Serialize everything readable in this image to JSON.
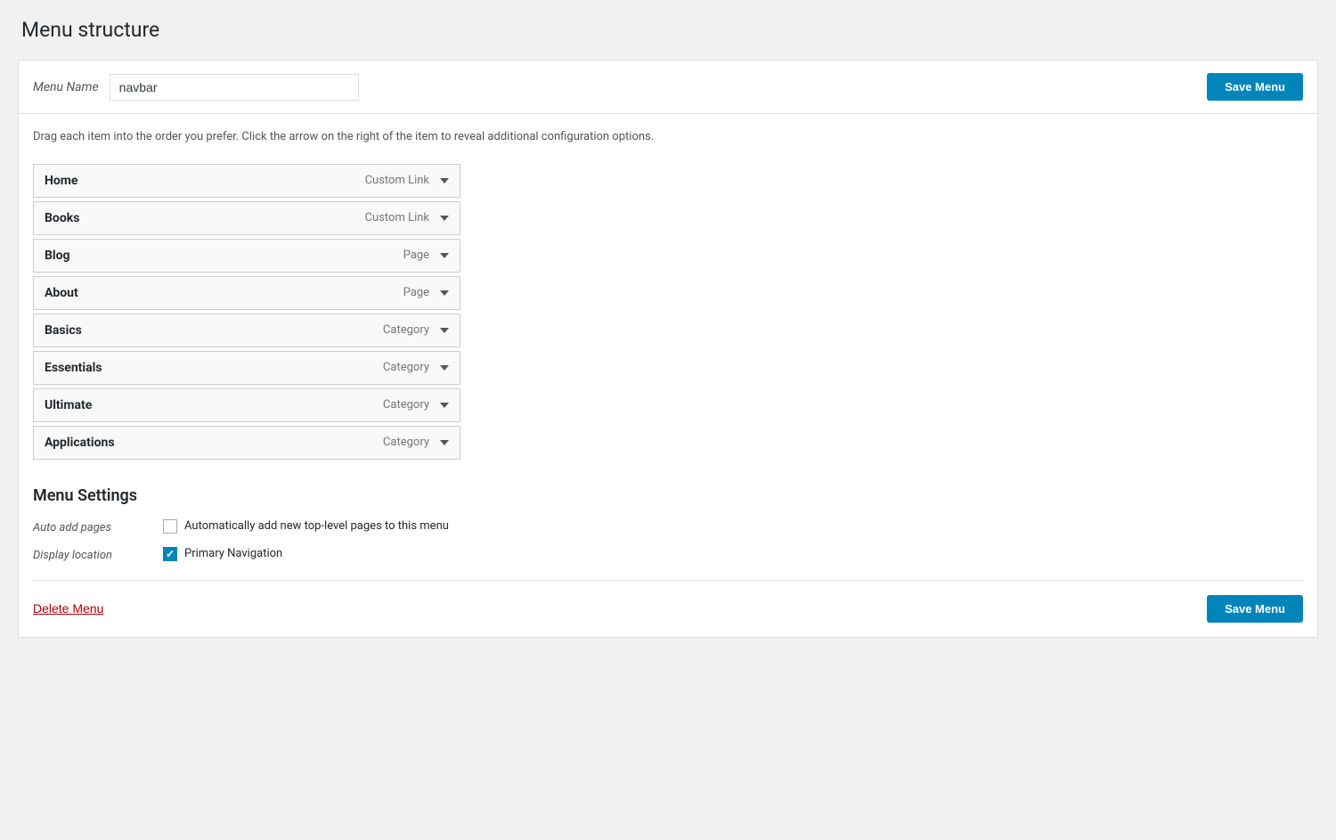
{
  "page": {
    "title": "Menu structure"
  },
  "menu_header": {
    "name_label": "Menu Name",
    "name_value": "navbar",
    "save_button_label": "Save Menu"
  },
  "menu_body": {
    "drag_instruction": "Drag each item into the order you prefer. Click the arrow on the right of the item to reveal additional configuration options.",
    "items": [
      {
        "name": "Home",
        "type": "Custom Link"
      },
      {
        "name": "Books",
        "type": "Custom Link"
      },
      {
        "name": "Blog",
        "type": "Page"
      },
      {
        "name": "About",
        "type": "Page"
      },
      {
        "name": "Basics",
        "type": "Category"
      },
      {
        "name": "Essentials",
        "type": "Category"
      },
      {
        "name": "Ultimate",
        "type": "Category"
      },
      {
        "name": "Applications",
        "type": "Category"
      }
    ]
  },
  "menu_settings": {
    "title": "Menu Settings",
    "auto_add_label": "Auto add pages",
    "auto_add_text": "Automatically add new top-level pages to this menu",
    "auto_add_checked": false,
    "display_location_label": "Display location",
    "display_location_text": "Primary Navigation",
    "display_location_checked": true
  },
  "footer": {
    "delete_label": "Delete Menu",
    "save_button_label": "Save Menu"
  }
}
